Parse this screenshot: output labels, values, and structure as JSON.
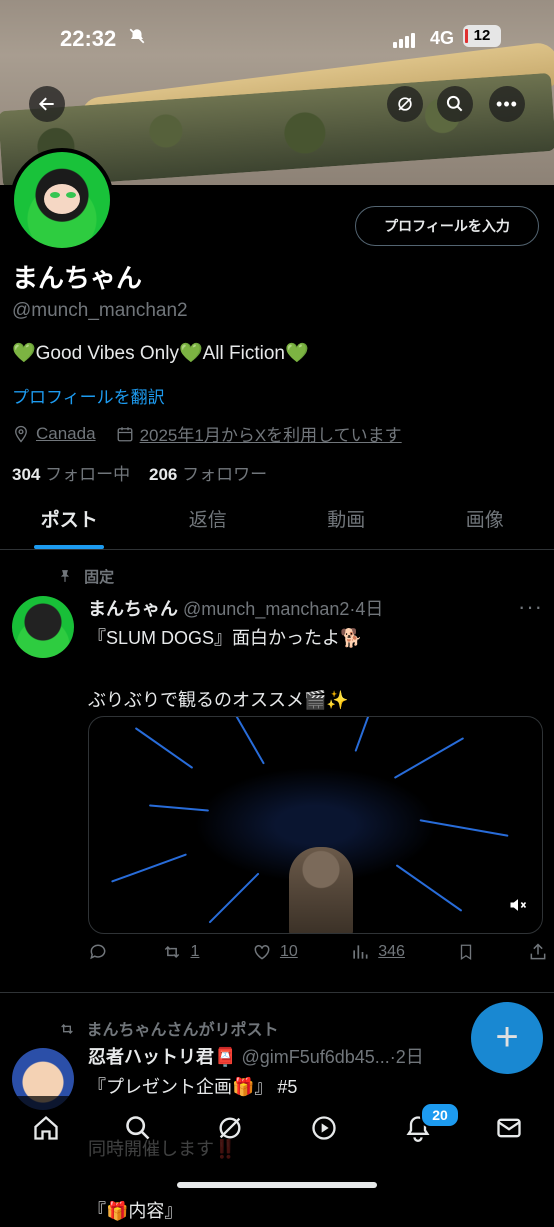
{
  "status_bar": {
    "time": "22:32",
    "network": "4G",
    "battery": "12"
  },
  "profile": {
    "edit_button": "プロフィールを入力",
    "name": "まんちゃん",
    "handle": "@munch_manchan2",
    "bio": "💚Good Vibes Only💚All Fiction💚",
    "translate": "プロフィールを翻訳",
    "location": "Canada",
    "joined": "2025年1月からXを利用しています",
    "following_count": "304",
    "following_label": "フォロー中",
    "followers_count": "206",
    "followers_label": "フォロワー"
  },
  "tabs": [
    "ポスト",
    "返信",
    "動画",
    "画像"
  ],
  "pinned_post": {
    "pinned_label": "固定",
    "author": "まんちゃん",
    "handle_time": "@munch_manchan2·4日",
    "text": "『SLUM DOGS』面白かったよ🐕\n\nぶりぶりで観るのオススメ🎬✨",
    "reposts": "1",
    "likes": "10",
    "views": "346"
  },
  "repost": {
    "repost_label": "まんちゃんさんがリポスト",
    "author": "忍者ハットリ君📮",
    "handle_time": "@gimF5uf6db45...·2日",
    "text": "『プレゼント企画🎁』 #5\n\n同時開催します‼️\n\n『🎁内容』"
  },
  "nav": {
    "notifications_badge": "20"
  },
  "colors": {
    "accent": "#1d9bf0",
    "background": "#000000",
    "muted": "#71767b"
  }
}
